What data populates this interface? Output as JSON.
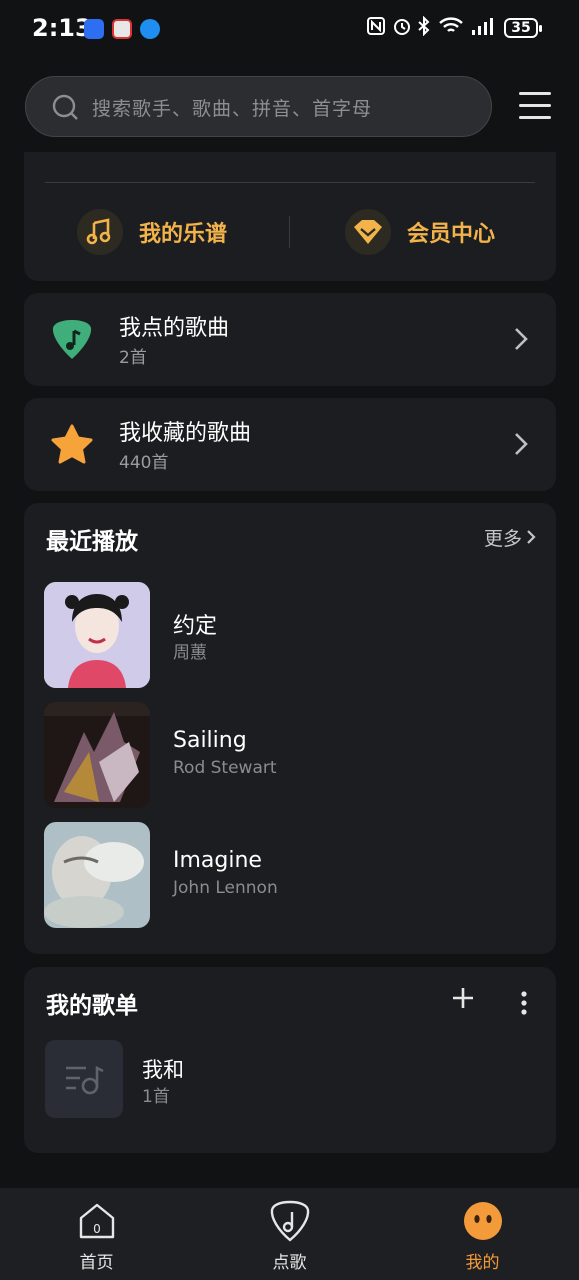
{
  "status_bar": {
    "time": "2:13",
    "battery": "35"
  },
  "search": {
    "placeholder": "搜索歌手、歌曲、拼音、首字母"
  },
  "quick_links": [
    {
      "label": "我的乐谱",
      "icon": "music-score-icon"
    },
    {
      "label": "会员中心",
      "icon": "vip-diamond-icon"
    }
  ],
  "list_cards": [
    {
      "title": "我点的歌曲",
      "count": "2首",
      "icon": "guitar-pick-icon"
    },
    {
      "title": "我收藏的歌曲",
      "count": "440首",
      "icon": "star-icon"
    }
  ],
  "recent": {
    "title": "最近播放",
    "more": "更多",
    "songs": [
      {
        "title": "约定",
        "artist": "周蕙"
      },
      {
        "title": "Sailing",
        "artist": "Rod Stewart"
      },
      {
        "title": "Imagine",
        "artist": "John Lennon"
      }
    ]
  },
  "playlists": {
    "title": "我的歌单",
    "items": [
      {
        "name": "我和",
        "count": "1首"
      }
    ]
  },
  "tabbar": {
    "tabs": [
      {
        "label": "首页",
        "icon": "home-icon"
      },
      {
        "label": "点歌",
        "icon": "song-request-icon"
      },
      {
        "label": "我的",
        "icon": "profile-face-icon"
      }
    ],
    "active": "我的"
  },
  "colors": {
    "accent_gold": "#f2b34a",
    "accent_orange": "#f39a3a",
    "pick_green": "#3fae7a",
    "star_orange": "#f6a43a"
  }
}
